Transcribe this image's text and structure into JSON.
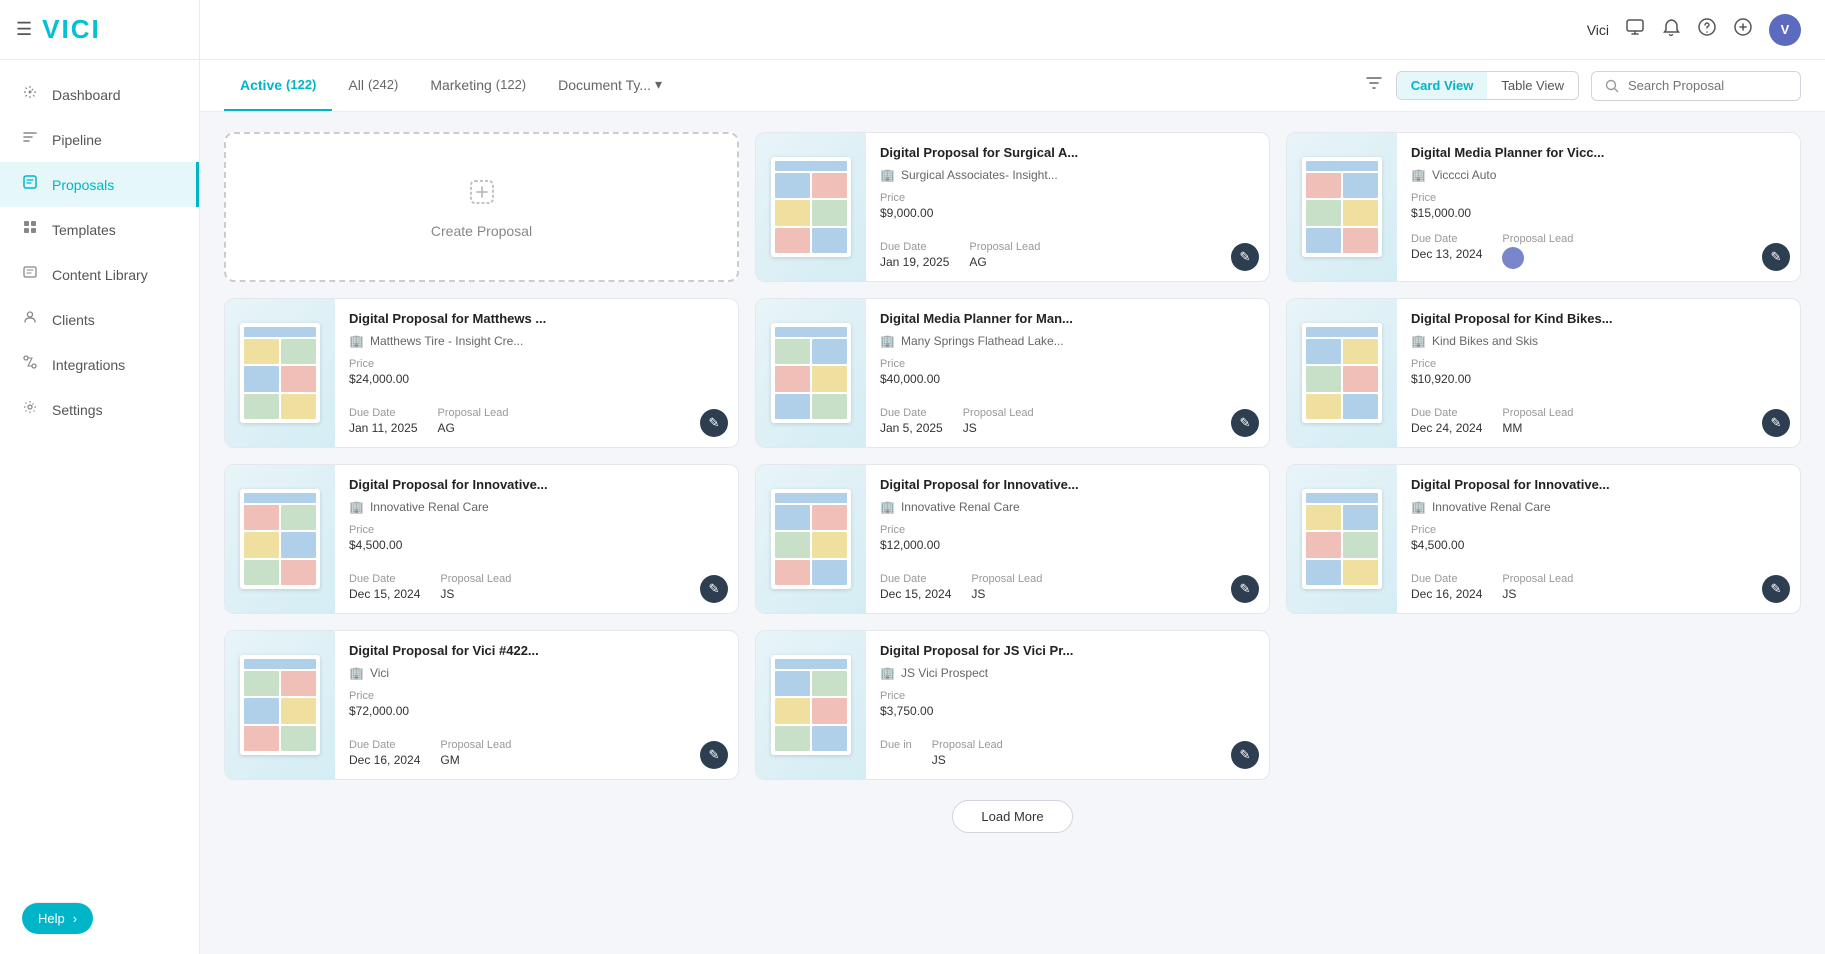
{
  "sidebar": {
    "logo": "VICI",
    "items": [
      {
        "id": "dashboard",
        "label": "Dashboard",
        "icon": "⊹"
      },
      {
        "id": "pipeline",
        "label": "Pipeline",
        "icon": "≋"
      },
      {
        "id": "proposals",
        "label": "Proposals",
        "icon": "⊡",
        "active": true
      },
      {
        "id": "templates",
        "label": "Templates",
        "icon": "☰"
      },
      {
        "id": "content-library",
        "label": "Content Library",
        "icon": "📖"
      },
      {
        "id": "clients",
        "label": "Clients",
        "icon": "👤"
      },
      {
        "id": "integrations",
        "label": "Integrations",
        "icon": "⚙"
      },
      {
        "id": "settings",
        "label": "Settings",
        "icon": "⚙"
      }
    ],
    "help_label": "Help"
  },
  "topbar": {
    "user": "Vici",
    "icons": [
      "monitor",
      "bell",
      "question",
      "plus"
    ]
  },
  "tabs": {
    "items": [
      {
        "id": "active",
        "label": "Active",
        "count": "(122)",
        "active": true
      },
      {
        "id": "all",
        "label": "All",
        "count": "(242)",
        "active": false
      },
      {
        "id": "marketing",
        "label": "Marketing",
        "count": "(122)",
        "active": false
      },
      {
        "id": "document-type",
        "label": "Document Ty...",
        "dropdown": true,
        "active": false
      }
    ],
    "views": {
      "card": "Card View",
      "table": "Table View",
      "active": "card"
    },
    "search": {
      "placeholder": "Search Proposal"
    },
    "filter_icon": "filter"
  },
  "create_card": {
    "label": "Create Proposal",
    "icon": "+"
  },
  "proposals": [
    {
      "id": 1,
      "title": "Digital Proposal for Surgical A...",
      "client": "Surgical Associates- Insight...",
      "price": "$9,000.00",
      "due_date": "Jan 19, 2025",
      "lead": "AG"
    },
    {
      "id": 2,
      "title": "Digital Media Planner for Vicc...",
      "client": "Vicccci Auto",
      "price": "$15,000.00",
      "due_date": "Dec 13, 2024",
      "lead": "avatar"
    },
    {
      "id": 3,
      "title": "Digital Proposal for Matthews ...",
      "client": "Matthews Tire - Insight Cre...",
      "price": "$24,000.00",
      "due_date": "Jan 11, 2025",
      "lead": "AG"
    },
    {
      "id": 4,
      "title": "Digital Media Planner for Man...",
      "client": "Many Springs Flathead Lake...",
      "price": "$40,000.00",
      "due_date": "Jan 5, 2025",
      "lead": "JS"
    },
    {
      "id": 5,
      "title": "Digital Proposal for Kind Bikes...",
      "client": "Kind Bikes and Skis",
      "price": "$10,920.00",
      "due_date": "Dec 24, 2024",
      "lead": "MM"
    },
    {
      "id": 6,
      "title": "Digital Proposal for Innovative...",
      "client": "Innovative Renal Care",
      "price": "$4,500.00",
      "due_date": "Dec 15, 2024",
      "lead": "JS"
    },
    {
      "id": 7,
      "title": "Digital Proposal for Innovative...",
      "client": "Innovative Renal Care",
      "price": "$12,000.00",
      "due_date": "Dec 15, 2024",
      "lead": "JS"
    },
    {
      "id": 8,
      "title": "Digital Proposal for Innovative...",
      "client": "Innovative Renal Care",
      "price": "$4,500.00",
      "due_date": "Dec 16, 2024",
      "lead": "JS"
    },
    {
      "id": 9,
      "title": "Digital Proposal for Vici #422...",
      "client": "Vici",
      "price": "$72,000.00",
      "due_date": "Dec 16, 2024",
      "lead": "GM"
    },
    {
      "id": 10,
      "title": "Digital Proposal for JS Vici Pr...",
      "client": "JS Vici Prospect",
      "price": "$3,750.00",
      "due_date": "",
      "lead": "JS"
    }
  ],
  "labels": {
    "price": "Price",
    "due_date": "Due Date",
    "proposal_lead": "Proposal Lead",
    "due_in": "Due in",
    "load_more": "Load More"
  }
}
